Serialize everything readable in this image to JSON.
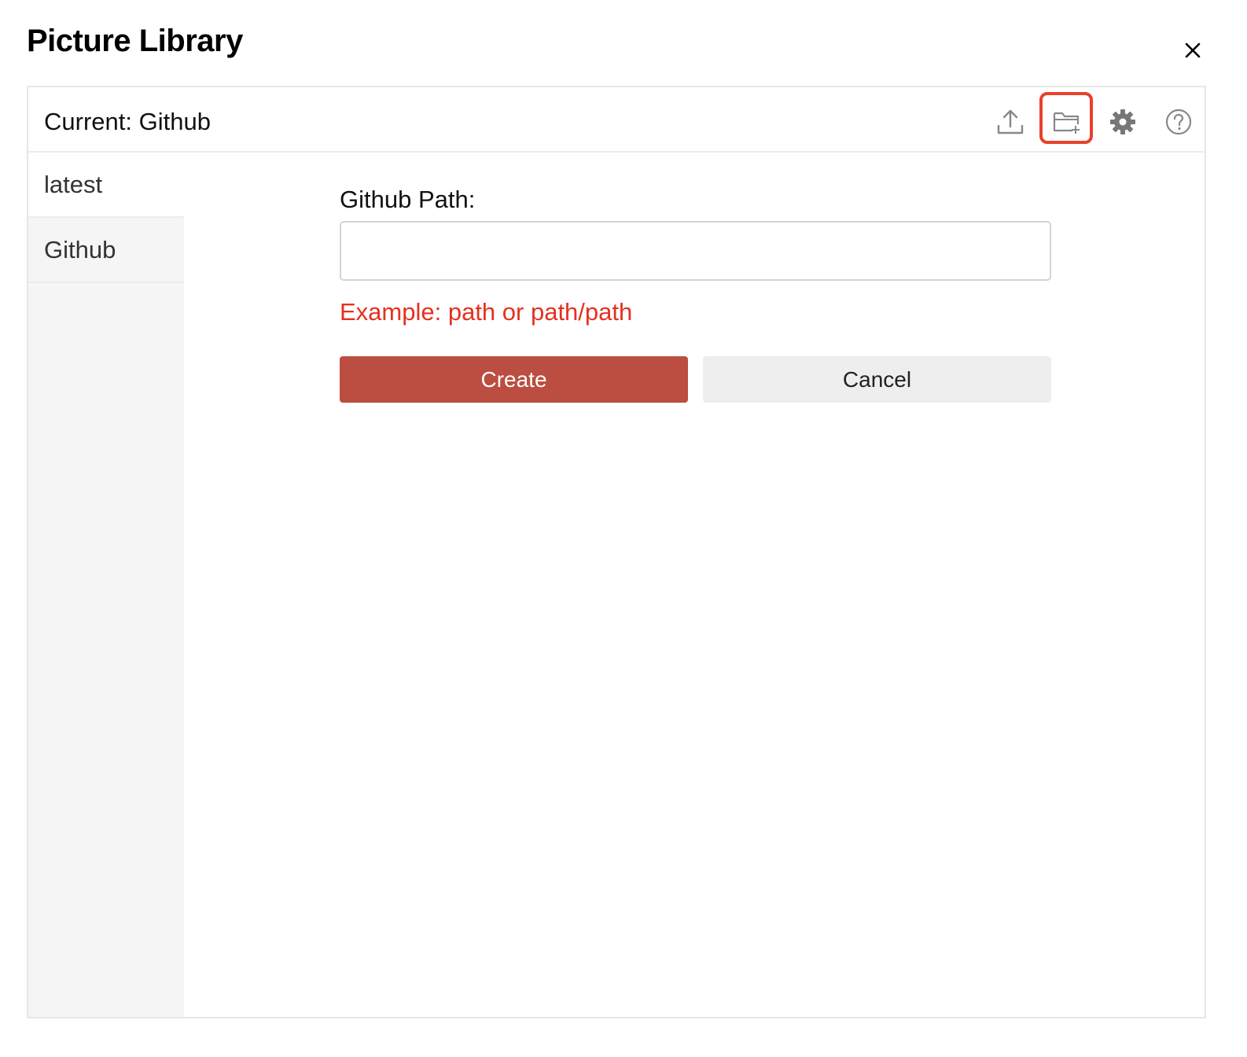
{
  "dialog": {
    "title": "Picture Library",
    "close_icon": "close-icon"
  },
  "header": {
    "current_label": "Current: Github",
    "tools": [
      {
        "name": "upload-icon"
      },
      {
        "name": "new-folder-icon",
        "highlighted": true
      },
      {
        "name": "gear-icon"
      },
      {
        "name": "help-icon"
      }
    ],
    "highlight_color": "#e8412c"
  },
  "sidebar": {
    "items": [
      {
        "label": "latest",
        "active": true
      },
      {
        "label": "Github",
        "active": false
      }
    ]
  },
  "form": {
    "field_label": "Github Path:",
    "input_value": "",
    "hint": "Example: path or path/path",
    "create_label": "Create",
    "cancel_label": "Cancel"
  },
  "colors": {
    "primary_button": "#bb4e40",
    "secondary_button": "#eeeeee",
    "hint_text": "#e5301f",
    "sidebar_bg": "#f5f5f5"
  }
}
